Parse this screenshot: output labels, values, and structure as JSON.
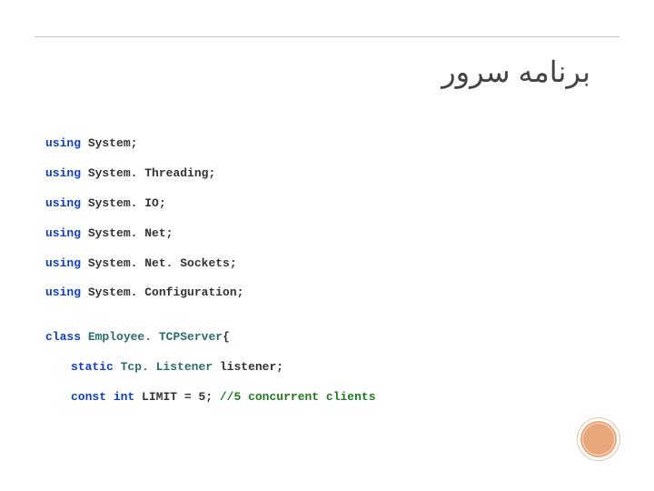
{
  "title": "برنامه سرور",
  "code": {
    "l1": {
      "kw": "using",
      "ns": "System;"
    },
    "l2": {
      "kw": "using",
      "ns": "System. Threading;"
    },
    "l3": {
      "kw": "using",
      "ns": "System. IO;"
    },
    "l4": {
      "kw": "using",
      "ns": "System. Net;"
    },
    "l5": {
      "kw": "using",
      "ns": "System. Net. Sockets;"
    },
    "l6": {
      "kw": "using",
      "ns": "System. Configuration;"
    },
    "l7": {
      "kw": "class",
      "name": "Employee. TCPServer",
      "brace": "{"
    },
    "l8": {
      "kw": "static",
      "type": "Tcp. Listener",
      "var": "listener;"
    },
    "l9": {
      "kw1": "const",
      "kw2": "int",
      "var": "LIMIT = 5;",
      "cmt": "//5 concurrent clients"
    }
  }
}
